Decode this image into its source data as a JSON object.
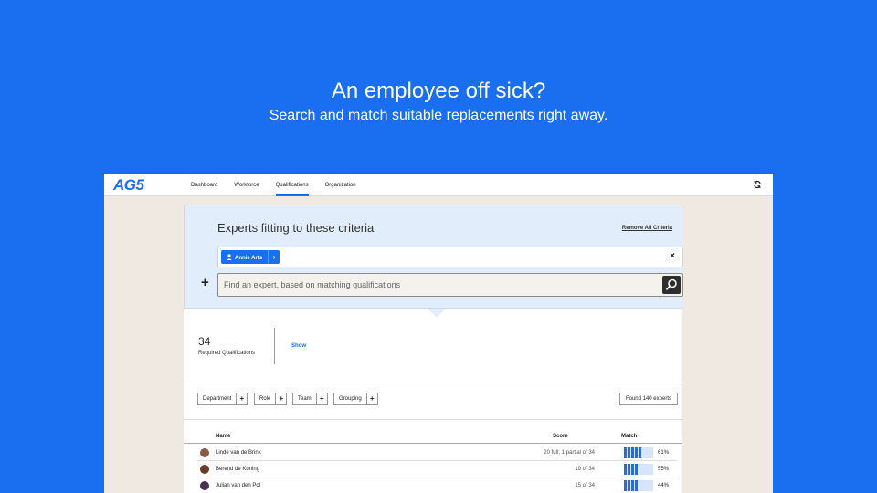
{
  "hero": {
    "headline": "An employee off sick?",
    "subline": "Search and match suitable replacements right away."
  },
  "app": {
    "logo": "AG5",
    "nav": [
      "Dashboard",
      "Workforce",
      "Qualifications",
      "Organization"
    ],
    "active_nav": "Qualifications",
    "accent": "#1a6ff0"
  },
  "criteria": {
    "title": "Experts fitting to these criteria",
    "remove_all": "Remove All Criteria",
    "chip_label": "Annie Arts",
    "chip_icon": "person-icon",
    "close_label": "×",
    "search_placeholder": "Find an expert, based on matching qualifications"
  },
  "stats": {
    "count": "34",
    "label": "Required Qualifications",
    "show": "Show"
  },
  "filters": {
    "items": [
      "Department",
      "Role",
      "Team",
      "Grouping"
    ],
    "found": "Found 140 experts"
  },
  "table": {
    "headers": {
      "name": "Name",
      "score": "Score",
      "match": "Match"
    },
    "rows": [
      {
        "name": "Linde van de Brink",
        "score": "20 full; 1 partial of 34",
        "match": 0.61,
        "pct": "61%"
      },
      {
        "name": "Berend de Koning",
        "score": "19 of 34",
        "match": 0.55,
        "pct": "55%"
      },
      {
        "name": "Julian van den Pol",
        "score": "15 of 34",
        "match": 0.44,
        "pct": "44%"
      }
    ]
  }
}
